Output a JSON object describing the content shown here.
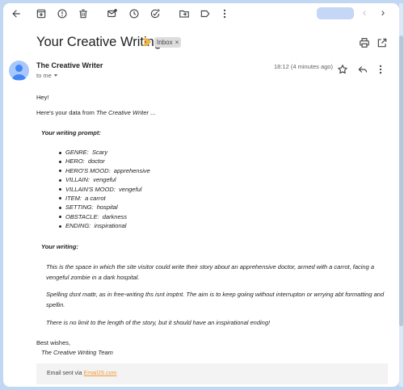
{
  "colors": {
    "accent": "#0b57d0",
    "important": "#f2b544",
    "link": "#f29b38",
    "background": "#c2d7f2"
  },
  "toolbar": {
    "icons": [
      "back-arrow-icon",
      "archive-icon",
      "report-spam-icon",
      "delete-icon",
      "mark-unread-icon",
      "snooze-icon",
      "add-task-icon",
      "move-to-icon",
      "label-icon",
      "more-icon"
    ],
    "pager_prev": "‹",
    "pager_next": "›"
  },
  "email": {
    "subject": "Your Creative Writing",
    "label": "Inbox",
    "label_close": "×",
    "sender": "The Creative Writer",
    "recipient": "to me",
    "time": "18:12 (4 minutes ago)",
    "greeting": "Hey!",
    "intro_text": "Here's your data from ",
    "intro_brand": "The Creative Writer",
    "intro_suffix": " ...",
    "prompt_heading": "Your writing prompt:",
    "prompt_items": [
      {
        "label": "GENRE:",
        "value": "Scary"
      },
      {
        "label": "HERO:",
        "value": "doctor"
      },
      {
        "label": "HERO'S MOOD:",
        "value": "apprehensive"
      },
      {
        "label": "VILLAIN:",
        "value": "vengeful"
      },
      {
        "label": "VILLAIN'S MOOD:",
        "value": "vengeful"
      },
      {
        "label": "ITEM:",
        "value": "a carrot"
      },
      {
        "label": "SETTING:",
        "value": "hospital"
      },
      {
        "label": "OBSTACLE:",
        "value": "darkness"
      },
      {
        "label": "ENDING:",
        "value": "inspirational"
      }
    ],
    "writing_heading": "Your writing:",
    "writing_para1_line1": "This is the space in which the site visitor could write their story about an apprehensive doctor, armed with a carrot, facing a",
    "writing_para1_line2": "vengeful zombie in a dark hospital.",
    "writing_para2_line1": "Spelling dsnt mattr, as in free-writing ths isnt imptnt. The aim is to keep goiing without interrupton or wrrying abt formatting and",
    "writing_para2_line2": "spellin.",
    "writing_para3": "There is no limit to the length of the story, but it should have an inspirational ending!",
    "signoff": "Best wishes,",
    "signature": "The Creative Writing Team",
    "footer_text": "Email sent via ",
    "footer_link": "EmailJS.com"
  }
}
